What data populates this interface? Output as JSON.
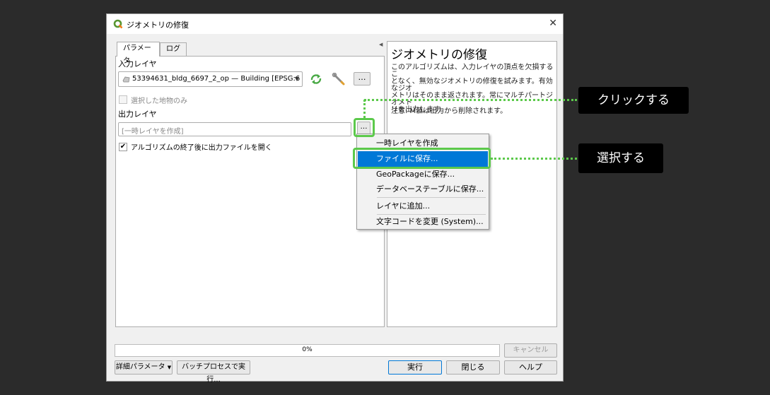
{
  "window": {
    "title": "ジオメトリの修復",
    "close_glyph": "✕"
  },
  "tabs": [
    {
      "label": "パラメータ"
    },
    {
      "label": "ログ"
    }
  ],
  "params": {
    "input_layer_label": "入力レイヤ",
    "input_layer_value": "53394631_bldg_6697_2_op — Building [EPSG:6",
    "selected_only_label": "選択した地物のみ",
    "output_layer_label": "出力レイヤ",
    "output_placeholder": "[一時レイヤを作成]",
    "open_output_label": "アルゴリズムの終了後に出力ファイルを開く",
    "more_button": "…",
    "browse_button": "…"
  },
  "help": {
    "title": "ジオメトリの修復",
    "lines": [
      "このアルゴリズムは、入力レイヤの頂点を欠損するこ",
      "となく、無効なジオメトリの修復を試みます。有効なジオ",
      "メトリはそのまま返されます。常にマルチパートジオメト",
      "リを出力します。"
    ],
    "note": "注意: M値は出力から削除されます。"
  },
  "dropdown": {
    "items": [
      "一時レイヤを作成",
      "ファイルに保存...",
      "GeoPackageに保存...",
      "データベーステーブルに保存...",
      "レイヤに追加...",
      "文字コードを変更 (System)..."
    ],
    "selected_index": 1
  },
  "annotations": {
    "click_label": "クリックする",
    "select_label": "選択する",
    "accent_color": "#5cc94b"
  },
  "progress": {
    "value": 0,
    "text": "0%"
  },
  "footer": {
    "advanced_label": "詳細パラメータ",
    "batch_label": "バッチプロセスで実行...",
    "cancel_label": "キャンセル",
    "run_label": "実行",
    "close_label": "閉じる",
    "help_label": "ヘルプ"
  }
}
